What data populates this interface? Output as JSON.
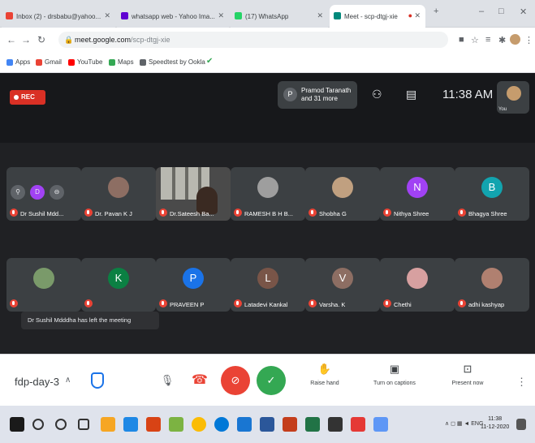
{
  "browser": {
    "tabs": [
      {
        "title": "Inbox (2) - drsbabu@yahoo..."
      },
      {
        "title": "whatsapp web - Yahoo Ima..."
      },
      {
        "title": "(17) WhatsApp"
      },
      {
        "title": "Meet - scp-dtgj-xie",
        "active": true
      }
    ],
    "url_host": "meet.google.com",
    "url_path": "/scp-dtgj-xie",
    "bookmarks": [
      "Apps",
      "Gmail",
      "YouTube",
      "Maps",
      "Speedtest by Ookla"
    ]
  },
  "meet": {
    "rec_label": "REC",
    "pinned": {
      "initial": "P",
      "text": "Pramod Taranath and 31 more"
    },
    "time": "11:38 AM",
    "self_label": "You",
    "participants_row1": [
      {
        "name": "Dr Sushil Mdd...",
        "initial": "D",
        "color": "#a142f4",
        "hover": true
      },
      {
        "name": "Dr. Pavan K J",
        "initial": "",
        "color": "#8d6e63",
        "photo": true
      },
      {
        "name": "Dr.Sateesh Ba...",
        "initial": "",
        "color": "#4a4a4a",
        "video": true
      },
      {
        "name": "RAMESH B H B...",
        "initial": "",
        "color": "#9e9e9e",
        "photo": true
      },
      {
        "name": "Shobha G",
        "initial": "",
        "color": "#c0a080",
        "photo": true
      },
      {
        "name": "Nithya Shree",
        "initial": "N",
        "color": "#a142f4"
      },
      {
        "name": "Bhagya Shree",
        "initial": "B",
        "color": "#12a4af"
      }
    ],
    "participants_row2": [
      {
        "name": "",
        "initial": "",
        "color": "#7a9a6a",
        "photo": true
      },
      {
        "name": "",
        "initial": "K",
        "color": "#0b8043"
      },
      {
        "name": "PRAVEEN P",
        "initial": "P",
        "color": "#1a73e8"
      },
      {
        "name": "Latadevi Kankal",
        "initial": "L",
        "color": "#795548"
      },
      {
        "name": "Varsha. K",
        "initial": "V",
        "color": "#8d6e63"
      },
      {
        "name": "Chethi",
        "initial": "",
        "color": "#d7a0a0",
        "photo": true
      },
      {
        "name": "adhi kashyap",
        "initial": "",
        "color": "#b08070",
        "photo": true
      }
    ],
    "toast": "Dr Sushil Mdddha has left the meeting",
    "meeting_code": "fdp-day-3",
    "actions": {
      "raise_hand": "Raise hand",
      "captions": "Turn on captions",
      "present": "Present now"
    },
    "colors": {
      "end_call": "#ea4335",
      "activities": "#34a853",
      "accent": "#1a73e8"
    }
  },
  "taskbar": {
    "time": "11:38",
    "date": "11-12-2020",
    "lang": "ENG"
  }
}
